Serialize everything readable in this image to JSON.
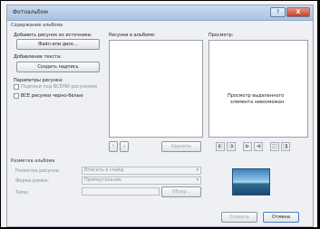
{
  "window": {
    "title": "Фотоальбом",
    "help": "?",
    "close": "X"
  },
  "album_content": {
    "header": "Содержание альбома",
    "add_from_label": "Добавить рисунок из источника:",
    "file_disk_button": "Файл или диск...",
    "add_text_label": "Добавление текста:",
    "new_caption_button": "Создать надпись",
    "pic_params_label": "Параметры рисунка:",
    "chk_captions": "Подписи под ВСЕМИ рисунками",
    "chk_bw": "ВСЕ рисунки черно-белые"
  },
  "pictures": {
    "label": "Рисунки в альбоме:",
    "up": "↑",
    "down": "↓",
    "delete_button": "Удалить"
  },
  "preview": {
    "label": "Просмотр:",
    "message_line1": "Просмотр выделенного",
    "message_line2": "элемента невозможен"
  },
  "tools": [
    "◐",
    "◑",
    "▶",
    "◀",
    "◫",
    "◨"
  ],
  "layout": {
    "header": "Разметка альбома",
    "pic_layout_label": "Разметка рисунка:",
    "pic_layout_value": "Вписать в слайд",
    "frame_label": "Форма рамки:",
    "frame_value": "Прямоугольник",
    "theme_label": "Тема:",
    "browse_button": "Обзор..."
  },
  "footer": {
    "create_button": "Создать",
    "cancel_button": "Отмена"
  }
}
